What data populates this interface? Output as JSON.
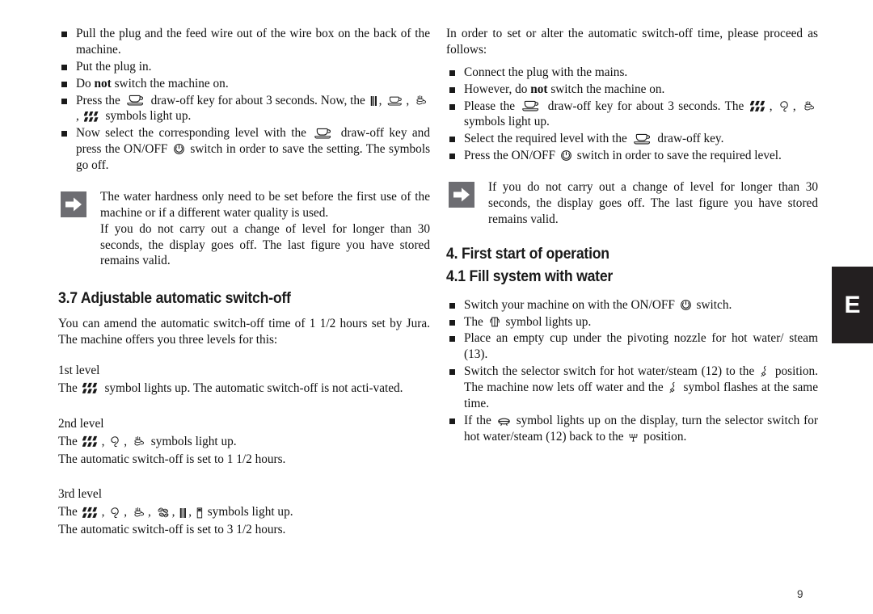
{
  "document": {
    "page_number": "9",
    "side_tab_label": "E",
    "language_tab_color": "#231f20",
    "note_icon_color": "#6d6d72"
  },
  "left_column": {
    "bullets_top": [
      "Pull the plug and the feed wire out of the wire box on the back of the machine.",
      "Put the plug in.",
      "Do not switch the machine on.",
      "Press the  draw-off key for about 3 seconds. Now, the , , ,  symbols light up.",
      "Now select the corresponding level with the  draw-off key and press the ON/OFF  switch in order to save the setting. The symbols go off."
    ],
    "bullet4": {
      "part1": "Press the",
      "part2": "draw-off key for about 3 seconds. Now, the",
      "comma": ",",
      "part3": "symbols light up."
    },
    "bullet3": {
      "pre": "Do",
      "bold": "not",
      "post": "switch the machine on."
    },
    "bullet5": {
      "part1": "Now select the corresponding level with the",
      "part2": "draw-off key and press the ON/OFF",
      "part3": "switch in order to save the setting. The symbols go off."
    },
    "note": {
      "line1": "The water hardness only need to be set before the first use of the machine or if a different water quality is used.",
      "line2": "If you do not carry out a change of level for longer than 30 seconds, the display goes off. The last figure you have stored remains valid."
    },
    "heading_37": "3.7 Adjustable automatic switch-off",
    "intro": "You can amend the automatic switch-off time of 1 1/2 hours set by Jura. The machine offers you three levels for this:",
    "levels": [
      {
        "title": "1st level",
        "line_pre": "The",
        "line_post": "symbol lights up. The automatic switch-off is not acti-vated.",
        "line2": ""
      },
      {
        "title": "2nd level",
        "line_pre": "The",
        "line_post": "symbols light up.",
        "line2": "The automatic switch-off is set to 1 1/2 hours."
      },
      {
        "title": "3rd level",
        "line_pre": "The",
        "line_post": "symbols light up.",
        "line2": "The automatic switch-off is set to 3 1/2 hours."
      }
    ]
  },
  "right_column": {
    "intro": "In order to set or alter the automatic switch-off time, please proceed as follows:",
    "bullets": {
      "b1": "Connect the plug with the mains.",
      "b2": {
        "pre": "However, do",
        "bold": "not",
        "post": "switch the machine on."
      },
      "b3": {
        "part1": "Please the",
        "part2": "draw-off key for about 3 seconds. The",
        "comma1": ",",
        "comma2": ",",
        "part3": "symbols light up."
      },
      "b4": {
        "part1": "Select the required level with the",
        "part2": "draw-off key."
      },
      "b5": {
        "part1": "Press the ON/OFF",
        "part2": "switch in order to save the required level."
      }
    },
    "note": "If you do not carry out a change of level for longer than 30 seconds, the display goes off. The last figure you have stored remains valid.",
    "heading_4": "4. First start of operation",
    "heading_41": "4.1 Fill system with water",
    "section4_bullets": {
      "s1": {
        "part1": "Switch your machine on with the ON/OFF",
        "part2": "switch."
      },
      "s2": {
        "part1": "The",
        "part2": "symbol lights up."
      },
      "s3": "Place an empty cup under the pivoting nozzle for hot water/ steam (13).",
      "s4": {
        "part1": "Switch the selector switch for hot water/steam (12) to the",
        "part2": "position. The machine now lets off water and the",
        "part3": "symbol flashes at the same time."
      },
      "s5": {
        "part1": "If the",
        "part2": "symbol lights up on the display, turn the selector switch for hot water/steam (12) back to the",
        "part3": "position."
      }
    }
  },
  "symbols": {
    "cup": "coffee-cup-drawoff-icon",
    "drops": "water-drops-icon",
    "kettle": "kettle-icon",
    "steam_flower": "steam-flower-icon",
    "beans": "coffee-beans-icon",
    "bars": "vertical-bars-icon",
    "tray": "drip-tray-icon",
    "power": "power-onoff-icon",
    "water_tank": "water-tank-icon",
    "steam_nozzle": "steam-nozzle-icon",
    "hot_water": "hot-water-icon",
    "off_position": "off-position-icon"
  }
}
